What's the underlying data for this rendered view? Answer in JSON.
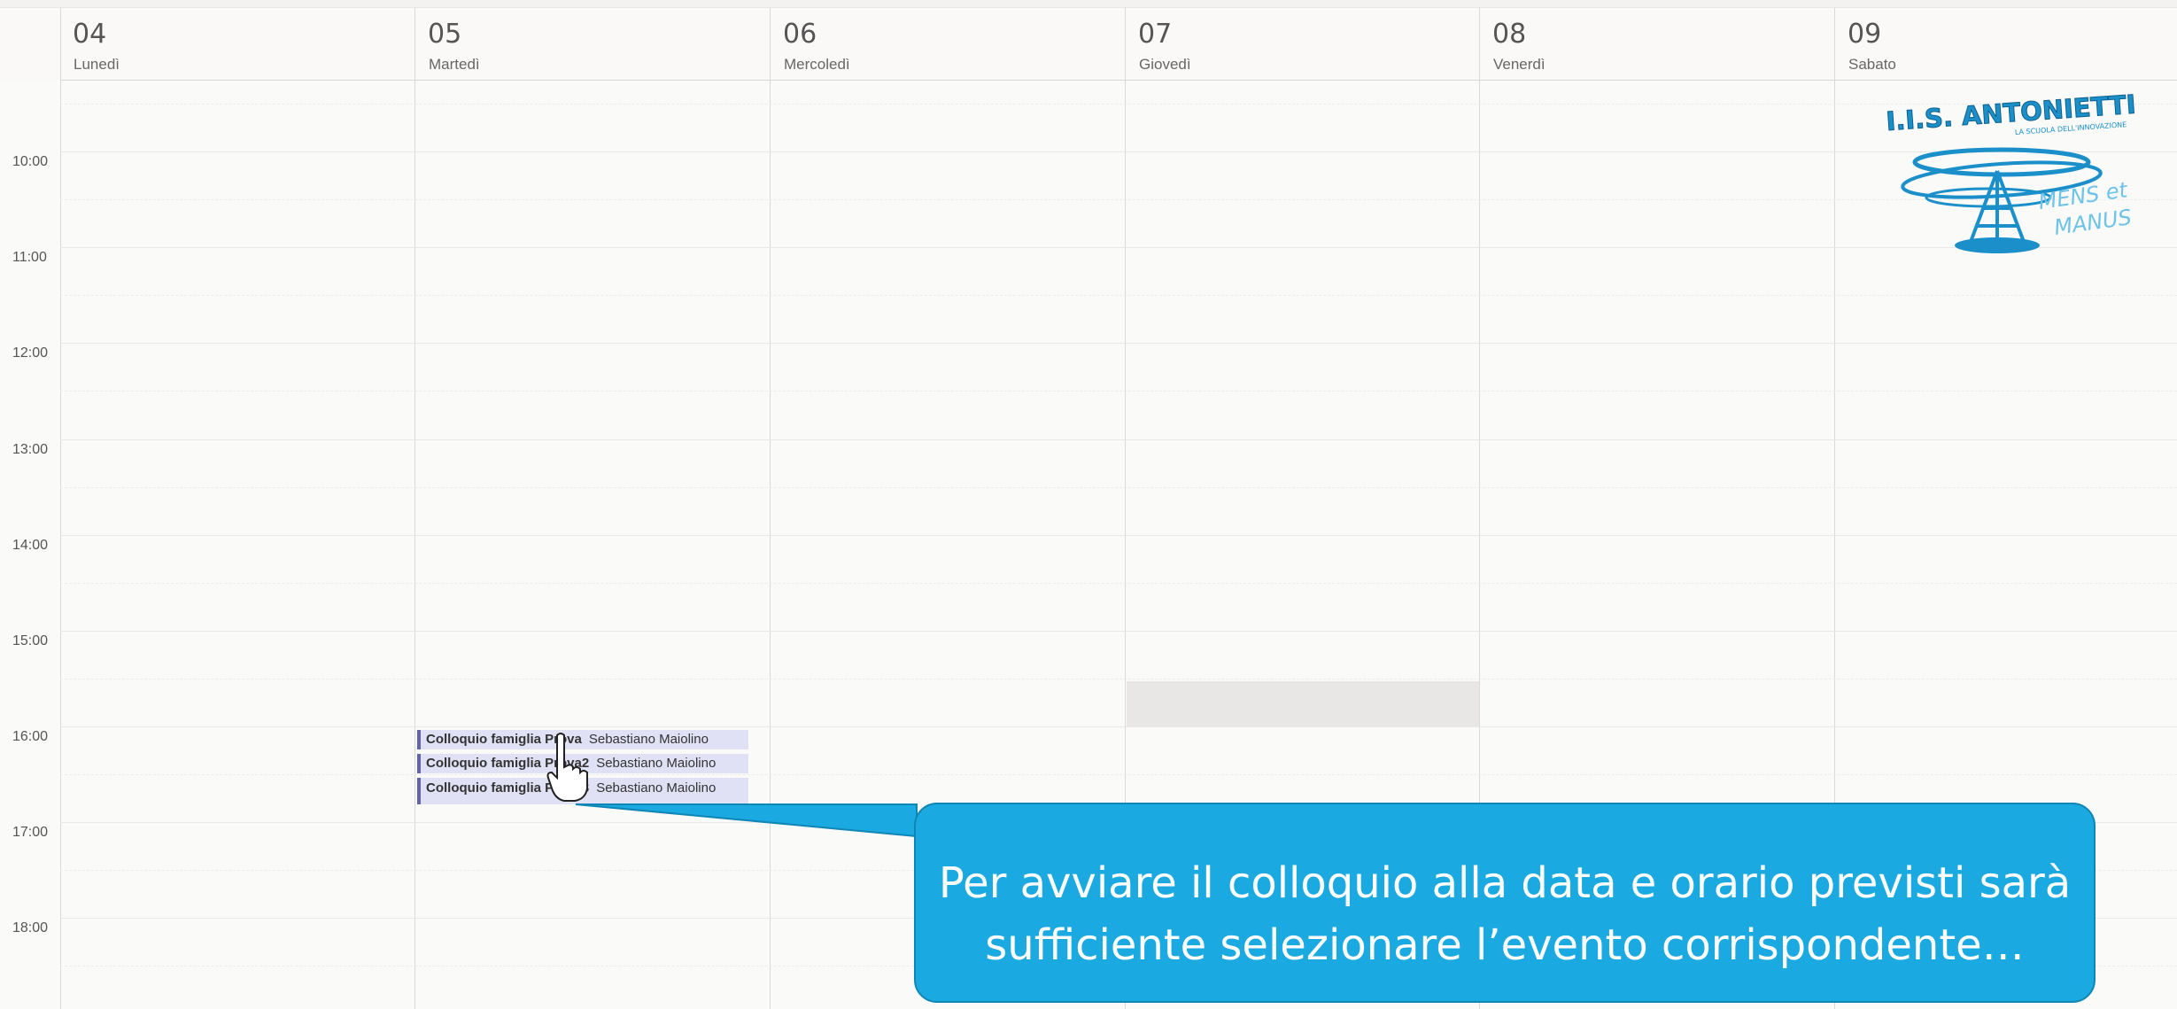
{
  "days": [
    {
      "num": "04",
      "name": "Lunedì"
    },
    {
      "num": "05",
      "name": "Martedì"
    },
    {
      "num": "06",
      "name": "Mercoledì"
    },
    {
      "num": "07",
      "name": "Giovedì"
    },
    {
      "num": "08",
      "name": "Venerdì"
    },
    {
      "num": "09",
      "name": "Sabato"
    }
  ],
  "hours": [
    "10:00",
    "11:00",
    "12:00",
    "13:00",
    "14:00",
    "15:00",
    "16:00",
    "17:00",
    "18:00"
  ],
  "events": [
    {
      "title": "Colloquio famiglia Prova",
      "organizer": "Sebastiano Maiolino"
    },
    {
      "title": "Colloquio famiglia Prova2",
      "organizer": "Sebastiano Maiolino"
    },
    {
      "title": "Colloquio famiglia Prova3",
      "organizer": "Sebastiano Maiolino"
    }
  ],
  "logo": {
    "name": "I.I.S. ANTONIETTI",
    "tagline": "LA SCUOLA DELL'INNOVAZIONE",
    "motto_line1": "MENS et",
    "motto_line2": "MANUS"
  },
  "callout": {
    "line1": "Per avviare il colloquio alla data e orario previsti sarà",
    "line2": "sufficiente selezionare l’evento corrispondente…"
  },
  "colors": {
    "accent": "#6264a7",
    "event_bg": "#e1e1f6",
    "callout": "#1aa9e0",
    "logo": "#1b8fc9"
  }
}
